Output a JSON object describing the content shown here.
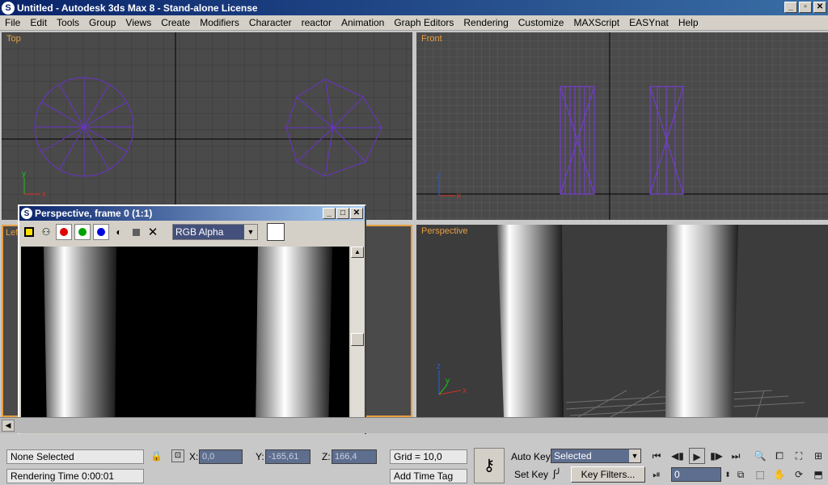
{
  "app": {
    "title": "Untitled - Autodesk 3ds Max 8 - Stand-alone License",
    "win_buttons": [
      "_",
      "▫",
      "✕"
    ]
  },
  "menu": [
    "File",
    "Edit",
    "Tools",
    "Group",
    "Views",
    "Create",
    "Modifiers",
    "Character",
    "reactor",
    "Animation",
    "Graph Editors",
    "Rendering",
    "Customize",
    "MAXScript",
    "EASYnat",
    "Help"
  ],
  "viewports": {
    "top": "Top",
    "front": "Front",
    "left": "Left",
    "perspective": "Perspective"
  },
  "axis": {
    "x": "x",
    "y": "y",
    "z": "z"
  },
  "render_window": {
    "title": "Perspective, frame 0 (1:1)",
    "channel": "RGB Alpha",
    "win_buttons": [
      "_",
      "□",
      "✕"
    ]
  },
  "status": {
    "selection": "None Selected",
    "rendering_time": "Rendering Time  0:00:01",
    "x_label": "X:",
    "x_value": "0,0",
    "y_label": "Y:",
    "y_value": "-165,61",
    "z_label": "Z:",
    "z_value": "166,4",
    "grid": "Grid = 10,0",
    "add_time_tag": "Add Time Tag",
    "auto_key": "Auto Key",
    "set_key": "Set Key",
    "key_filters": "Key Filters...",
    "selected": "Selected",
    "frame": "0"
  },
  "icons": {
    "key": "key-icon",
    "playback": [
      "go-to-start-icon",
      "previous-frame-icon",
      "play-icon",
      "next-frame-icon",
      "go-to-end-icon"
    ]
  }
}
